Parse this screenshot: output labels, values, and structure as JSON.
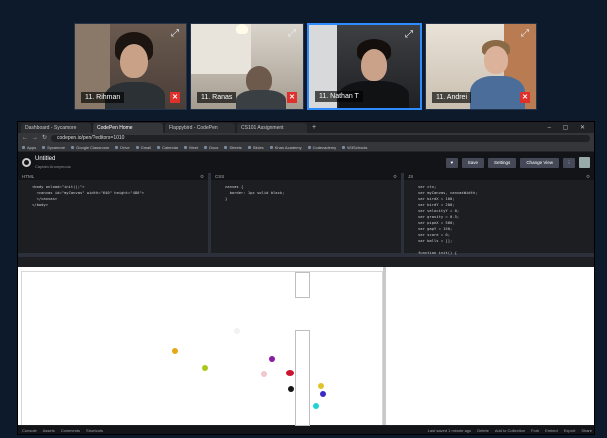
{
  "participants": [
    {
      "name": "11. Rihman",
      "muted": true
    },
    {
      "name": "11. Ranas",
      "muted": true
    },
    {
      "name": "11. Nathan T",
      "muted": false,
      "active": true
    },
    {
      "name": "11. Andrei",
      "muted": true
    }
  ],
  "icons": {
    "expand": "⤢",
    "mute": "mic-off-icon",
    "settings": "⚙",
    "back": "←",
    "forward": "→",
    "reload": "↻",
    "tab_add": "+",
    "window_controls": "– ▢ ✕"
  },
  "browser": {
    "tabs": [
      "Dashboard - Sycamore",
      "CodePen Home",
      "Flappybird - CodePen",
      "CS101 Assignment"
    ],
    "url": "codepen.io/pen/?editors=1010",
    "bookmarks": [
      "Apps",
      "Sycamore",
      "Google Classroom",
      "Drive",
      "Gmail",
      "Calendar",
      "Meet",
      "Docs",
      "Sheets",
      "Slides",
      "Khan Academy",
      "Codecademy",
      "W3Schools"
    ]
  },
  "codepen": {
    "title": "Untitled",
    "subtitle": "Captain Anonymous",
    "buttons": {
      "save": "Save",
      "settings": "Settings",
      "change_view": "Change View"
    },
    "panels": [
      {
        "name": "HTML",
        "code": "<body onload=\"init();\">\n  <canvas id=\"myCanvas\" width=\"640\" height=\"480\">\n  </canvas>\n</body>"
      },
      {
        "name": "CSS",
        "code": "canvas {\n  border: 1px solid black;\n}"
      },
      {
        "name": "JS",
        "code": "var ctx;\nvar myCanvas, canvasWidth;\nvar birdX = 100;\nvar birdY = 200;\nvar velocityY = 0;\nvar gravity = 0.5;\nvar pipeX = 500;\nvar gapY = 150;\nvar score = 0;\nvar balls = [];\n\nfunction init() {"
      }
    ],
    "status": [
      "Console",
      "Assets",
      "Comments",
      "Shortcuts"
    ],
    "status_right": [
      "Last saved 1 minute ago",
      "Delete",
      "Add to Collection",
      "Fork",
      "Embed",
      "Export",
      "Share"
    ]
  },
  "colors": {
    "background": "#0c1a2b",
    "active_border": "#2d8cff",
    "mute": "#e0302c",
    "ball_colors": [
      "#e6a817",
      "#a8c91c",
      "#8a1aa6",
      "#f1c6cf",
      "#cc1430",
      "#161616",
      "#e3c32a",
      "#3a2bc7",
      "#21d2d2",
      "#f2f2f2"
    ]
  }
}
